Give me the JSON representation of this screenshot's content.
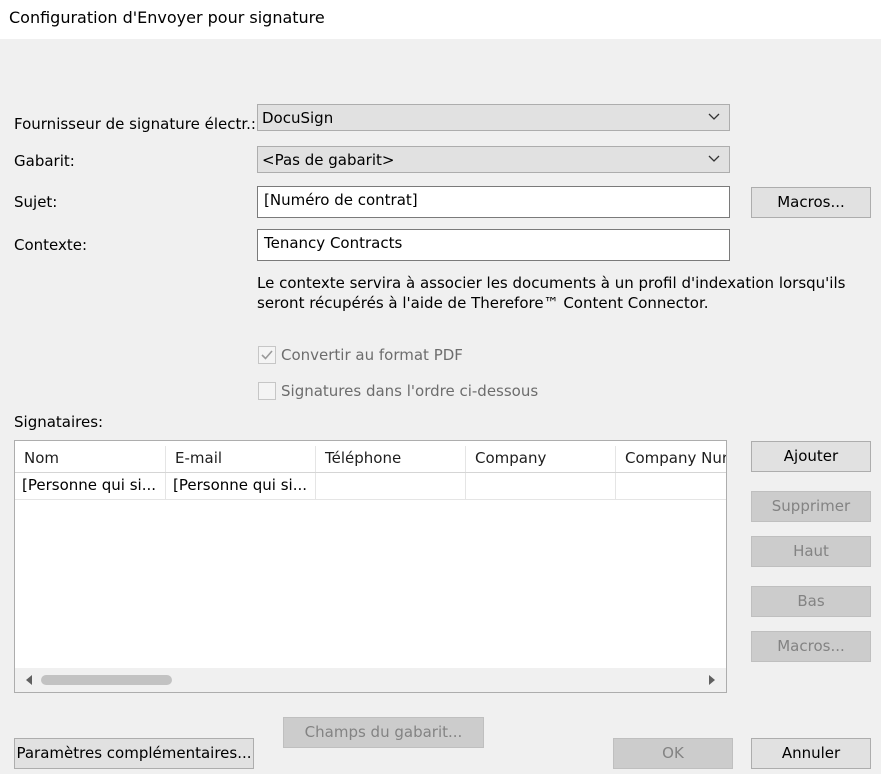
{
  "window": {
    "title": "Configuration d'Envoyer pour signature"
  },
  "form": {
    "provider_label": "Fournisseur de signature électr.:",
    "provider_value": "DocuSign",
    "template_label": "Gabarit:",
    "template_value": "<Pas de gabarit>",
    "subject_label": "Sujet:",
    "subject_value": "[Numéro de contrat]",
    "subject_macros_button": "Macros...",
    "context_label": "Contexte:",
    "context_value": "Tenancy Contracts",
    "context_description_line1": "Le contexte servira à associer les documents à un profil d'indexation lorsqu'ils",
    "context_description_line2": "seront récupérés à l'aide de Therefore™ Content Connector.",
    "convert_pdf_label": "Convertir au format PDF",
    "convert_pdf_checked": true,
    "order_label": "Signatures dans l'ordre ci-dessous",
    "order_checked": false
  },
  "signers": {
    "label": "Signataires:",
    "columns": [
      "Nom",
      "E-mail",
      "Téléphone",
      "Company",
      "Company Nur"
    ],
    "rows": [
      [
        "[Personne qui si...",
        "[Personne qui si...",
        "",
        "",
        ""
      ]
    ],
    "buttons": {
      "add": "Ajouter",
      "remove": "Supprimer",
      "up": "Haut",
      "down": "Bas",
      "macros": "Macros..."
    }
  },
  "footer": {
    "additional_params": "Paramètres complémentaires...",
    "template_fields": "Champs du gabarit...",
    "ok": "OK",
    "cancel": "Annuler"
  },
  "icons": {
    "dropdown": "chevron-down-icon",
    "scroll_left": "triangle-left-icon",
    "scroll_right": "triangle-right-icon",
    "checkmark": "checkmark-icon"
  }
}
